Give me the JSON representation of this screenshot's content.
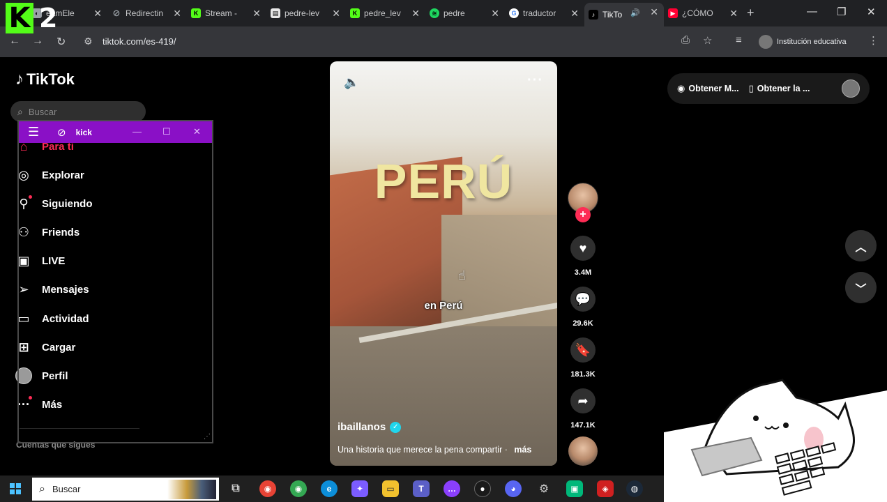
{
  "browser": {
    "tabs": [
      {
        "label": "eamEle",
        "icon": "streamelements-icon",
        "color": "#9aa0a6"
      },
      {
        "label": "Redirectin",
        "icon": "globe-icon",
        "color": "#9aa0a6"
      },
      {
        "label": "Stream - ",
        "icon": "kick-icon",
        "color": "#53fc18"
      },
      {
        "label": "pedre-lev",
        "icon": "page-icon",
        "color": "#e8e8e8"
      },
      {
        "label": "pedre_lev",
        "icon": "kick-icon",
        "color": "#53fc18"
      },
      {
        "label": "pedre",
        "icon": "spotify-icon",
        "color": "#1ed760"
      },
      {
        "label": "traductor",
        "icon": "google-icon",
        "color": "#ffffff"
      },
      {
        "label": "TikTo",
        "icon": "tiktok-icon",
        "color": "#000000"
      },
      {
        "label": "¿CÓMO ",
        "icon": "youtube-icon",
        "color": "#ff0033"
      }
    ],
    "url": "tiktok.com/es-419/",
    "profile_label": "Institución educativa"
  },
  "overlay_logo": {
    "letter": "K",
    "number": "2"
  },
  "tiktok": {
    "brand": "TikTok",
    "search_placeholder": "Buscar",
    "nav": [
      {
        "label": "Para ti",
        "icon": "home-icon"
      },
      {
        "label": "Explorar",
        "icon": "compass-icon"
      },
      {
        "label": "Siguiendo",
        "icon": "following-icon"
      },
      {
        "label": "Friends",
        "icon": "friends-icon"
      },
      {
        "label": "LIVE",
        "icon": "live-icon"
      },
      {
        "label": "Mensajes",
        "icon": "messages-icon"
      },
      {
        "label": "Actividad",
        "icon": "activity-icon"
      },
      {
        "label": "Cargar",
        "icon": "upload-icon"
      },
      {
        "label": "Perfil",
        "icon": "profile-avatar"
      },
      {
        "label": "Más",
        "icon": "more-icon"
      }
    ],
    "following_accounts_label": "Cuentas que sigues",
    "video": {
      "title_overlay": "PERÚ",
      "caption": "en Perú",
      "author": "ibaillanos",
      "description": "Una historia que merece la pena compartir ·",
      "more_label": "más"
    },
    "actions": {
      "likes": "3.4M",
      "comments": "29.6K",
      "saves": "181.3K",
      "shares": "147.1K"
    },
    "get_bar": {
      "item1": "Obtener M...",
      "item2": "Obtener la ..."
    }
  },
  "kick_window": {
    "title": "kick"
  },
  "taskbar": {
    "search_placeholder": "Buscar",
    "apps": [
      {
        "name": "chrome-icon",
        "color": "#e84335"
      },
      {
        "name": "chrome-icon-2",
        "color": "#34a853"
      },
      {
        "name": "edge-icon",
        "color": "#0c8ed9"
      },
      {
        "name": "copilot-icon",
        "color": "#7b5cff"
      },
      {
        "name": "file-explorer-icon",
        "color": "#f2c12e"
      },
      {
        "name": "teams-icon",
        "color": "#5b5fc7"
      },
      {
        "name": "chat-icon",
        "color": "#8a3ffc"
      },
      {
        "name": "obs-icon",
        "color": "#1a1a1a"
      },
      {
        "name": "discord-icon",
        "color": "#5865f2"
      },
      {
        "name": "settings-icon",
        "color": "#888888"
      },
      {
        "name": "app-green-icon",
        "color": "#00b87a"
      },
      {
        "name": "app-red-icon",
        "color": "#d02020"
      },
      {
        "name": "steam-icon",
        "color": "#1b2838"
      }
    ]
  }
}
